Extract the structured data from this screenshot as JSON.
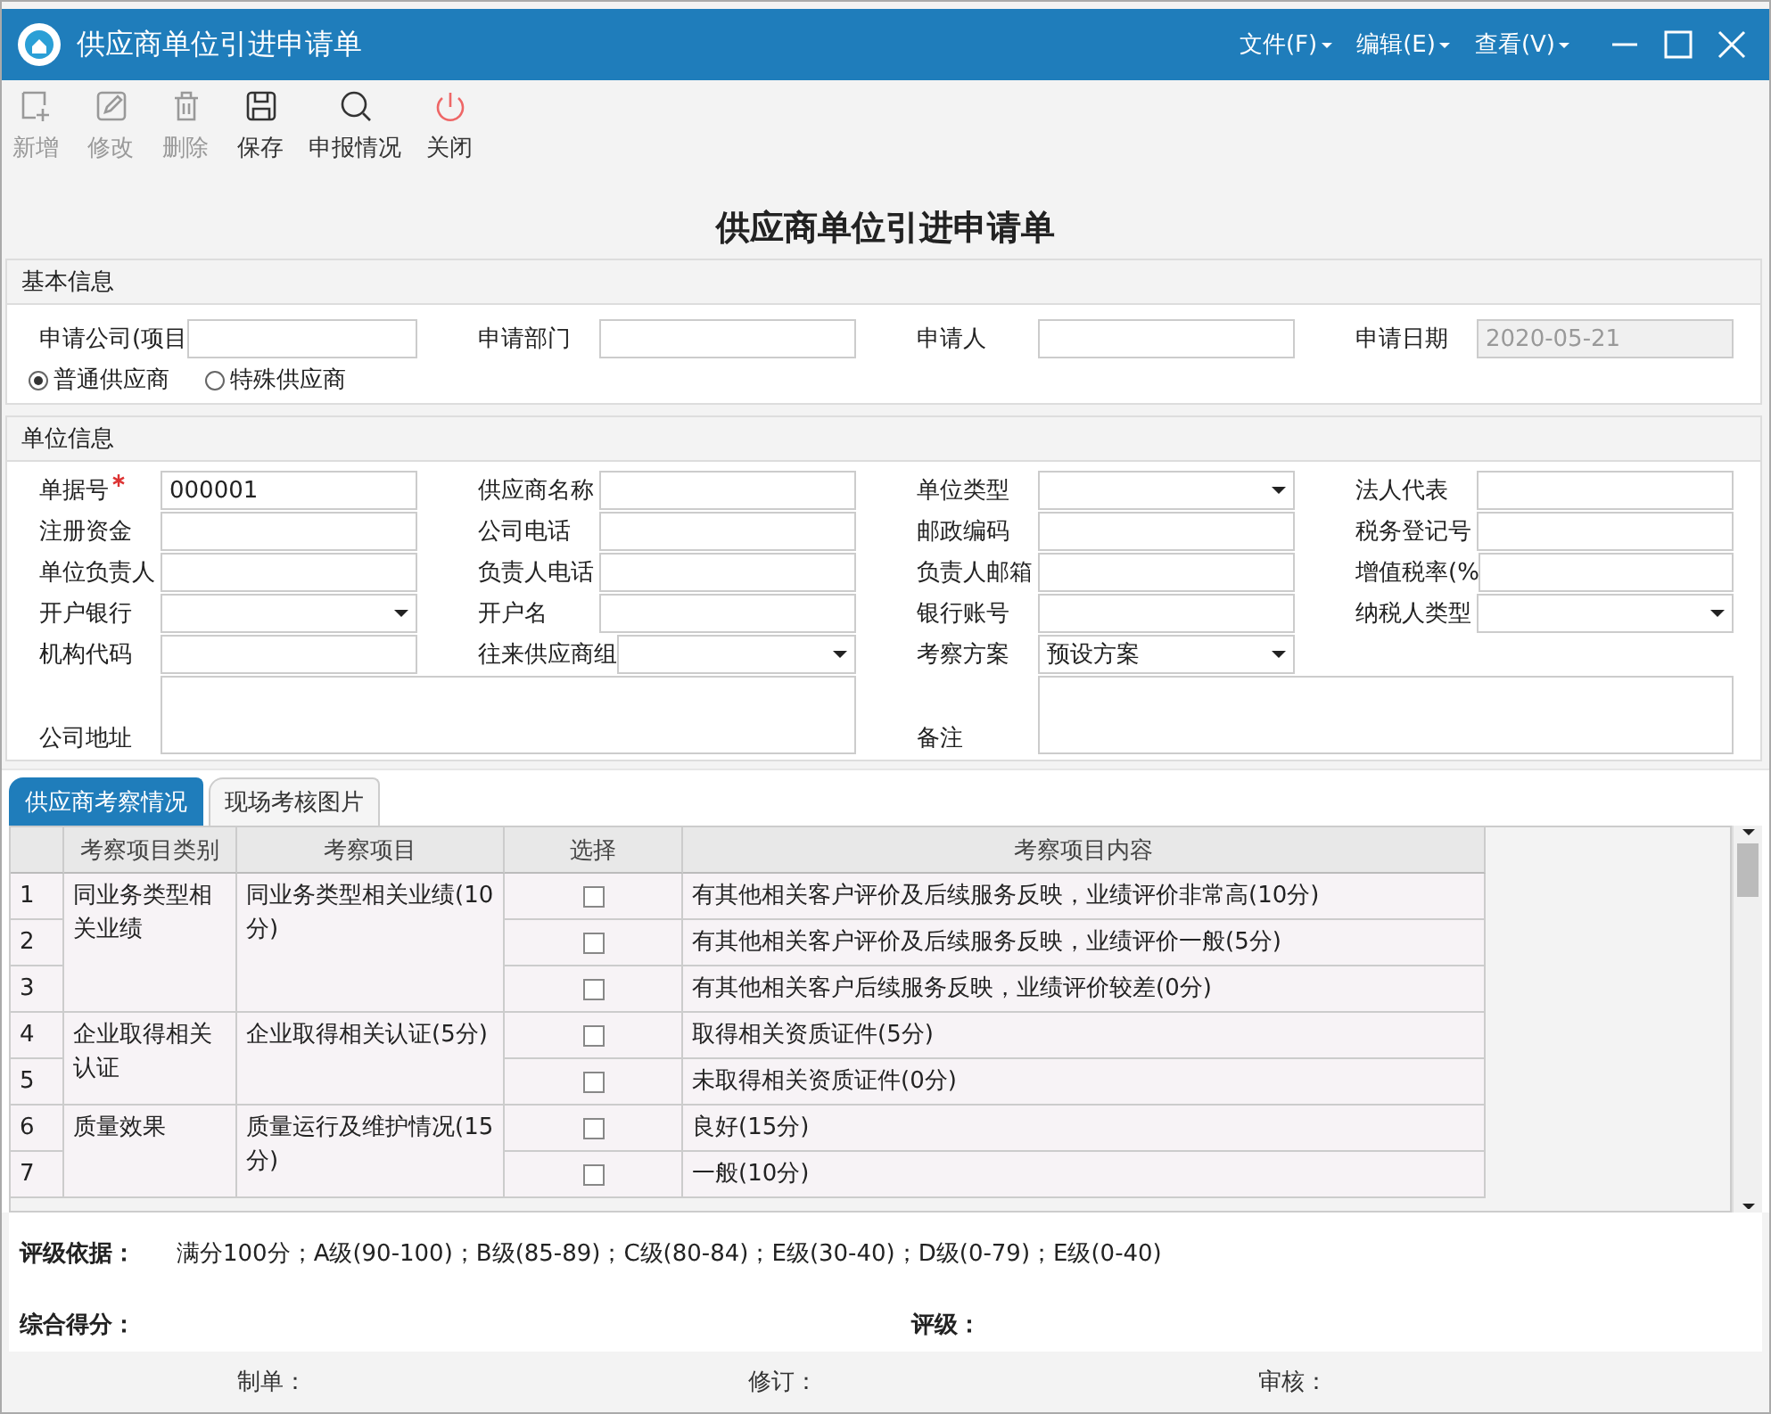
{
  "window": {
    "title": "供应商单位引进申请单",
    "menus": [
      "文件(F)",
      "编辑(E)",
      "查看(V)"
    ]
  },
  "toolbar": [
    {
      "label": "新增",
      "kind": "add",
      "disabled": true
    },
    {
      "label": "修改",
      "kind": "edit",
      "disabled": true
    },
    {
      "label": "删除",
      "kind": "delete",
      "disabled": true
    },
    {
      "label": "保存",
      "kind": "save",
      "disabled": false
    },
    {
      "label": "申报情况",
      "kind": "search",
      "disabled": false
    },
    {
      "label": "关闭",
      "kind": "power",
      "disabled": false
    }
  ],
  "form_title": "供应商单位引进申请单",
  "basic_info": {
    "title": "基本信息",
    "fields": [
      {
        "label": "申请公司(项目",
        "disabled": false
      },
      {
        "label": "申请部门",
        "disabled": false
      },
      {
        "label": "申请人",
        "disabled": false
      },
      {
        "label": "申请日期",
        "value": "2020-05-21",
        "disabled": true
      }
    ],
    "radios": [
      {
        "label": "普通供应商",
        "selected": true
      },
      {
        "label": "特殊供应商",
        "selected": false
      }
    ]
  },
  "unit_info": {
    "title": "单位信息",
    "fields": [
      {
        "label": "单据号",
        "kind": "text",
        "value": "000001",
        "required": true
      },
      {
        "label": "供应商名称",
        "kind": "text",
        "required": false
      },
      {
        "label": "单位类型",
        "kind": "select",
        "required": false
      },
      {
        "label": "法人代表",
        "kind": "text",
        "required": false
      },
      {
        "label": "注册资金",
        "kind": "text",
        "required": false
      },
      {
        "label": "公司电话",
        "kind": "text",
        "required": false
      },
      {
        "label": "邮政编码",
        "kind": "text",
        "required": false
      },
      {
        "label": "税务登记号",
        "kind": "text",
        "required": false
      },
      {
        "label": "单位负责人",
        "kind": "text",
        "required": false
      },
      {
        "label": "负责人电话",
        "kind": "text",
        "required": false
      },
      {
        "label": "负责人邮箱",
        "kind": "text",
        "required": false
      },
      {
        "label": "增值税率(%",
        "kind": "text",
        "required": false
      },
      {
        "label": "开户银行",
        "kind": "select",
        "required": false
      },
      {
        "label": "开户名",
        "kind": "text",
        "required": false
      },
      {
        "label": "银行账号",
        "kind": "text",
        "required": false
      },
      {
        "label": "纳税人类型",
        "kind": "select",
        "required": false
      },
      {
        "label": "机构代码",
        "kind": "text",
        "required": false
      },
      {
        "label": "往来供应商组",
        "kind": "select",
        "required": false
      },
      {
        "label": "考察方案",
        "kind": "select",
        "value": "预设方案",
        "required": false
      },
      {
        "label": "公司地址",
        "kind": "textarea",
        "required": false
      },
      {
        "label": "备注",
        "kind": "textarea",
        "required": false
      }
    ]
  },
  "tabs": [
    {
      "label": "供应商考察情况",
      "selected": true
    },
    {
      "label": "现场考核图片",
      "selected": false
    }
  ],
  "table": {
    "columns": [
      "考察项目类别",
      "考察项目",
      "选择",
      "考察项目内容"
    ],
    "groups": [
      {
        "category": "同业务类型相关业绩",
        "item": "同业务类型相关业绩(10分)",
        "rows": [
          {
            "number": "1",
            "checked": false,
            "content": "有其他相关客户评价及后续服务反映，业绩评价非常高(10分)"
          },
          {
            "number": "2",
            "checked": false,
            "content": "有其他相关客户评价及后续服务反映，业绩评价一般(5分)"
          },
          {
            "number": "3",
            "checked": false,
            "content": "有其他相关客户后续服务反映，业绩评价较差(0分)"
          }
        ]
      },
      {
        "category": "企业取得相关认证",
        "item": "企业取得相关认证(5分)",
        "rows": [
          {
            "number": "4",
            "checked": false,
            "content": "取得相关资质证件(5分)"
          },
          {
            "number": "5",
            "checked": false,
            "content": "未取得相关资质证件(0分)"
          }
        ]
      },
      {
        "category": "质量效果",
        "item": "质量运行及维护情况(15分)",
        "rows": [
          {
            "number": "6",
            "checked": false,
            "content": "良好(15分)"
          },
          {
            "number": "7",
            "checked": false,
            "content": "一般(10分)"
          }
        ]
      }
    ]
  },
  "rating_basis": {
    "label": "评级依据：",
    "text": "满分100分；A级(90-100)；B级(85-89)；C级(80-84)；E级(30-40)；D级(0-79)；E级(0-40)"
  },
  "score": {
    "label": "综合得分：",
    "rating_label": "评级："
  },
  "footer": [
    "制单：",
    "修订：",
    "审核："
  ]
}
